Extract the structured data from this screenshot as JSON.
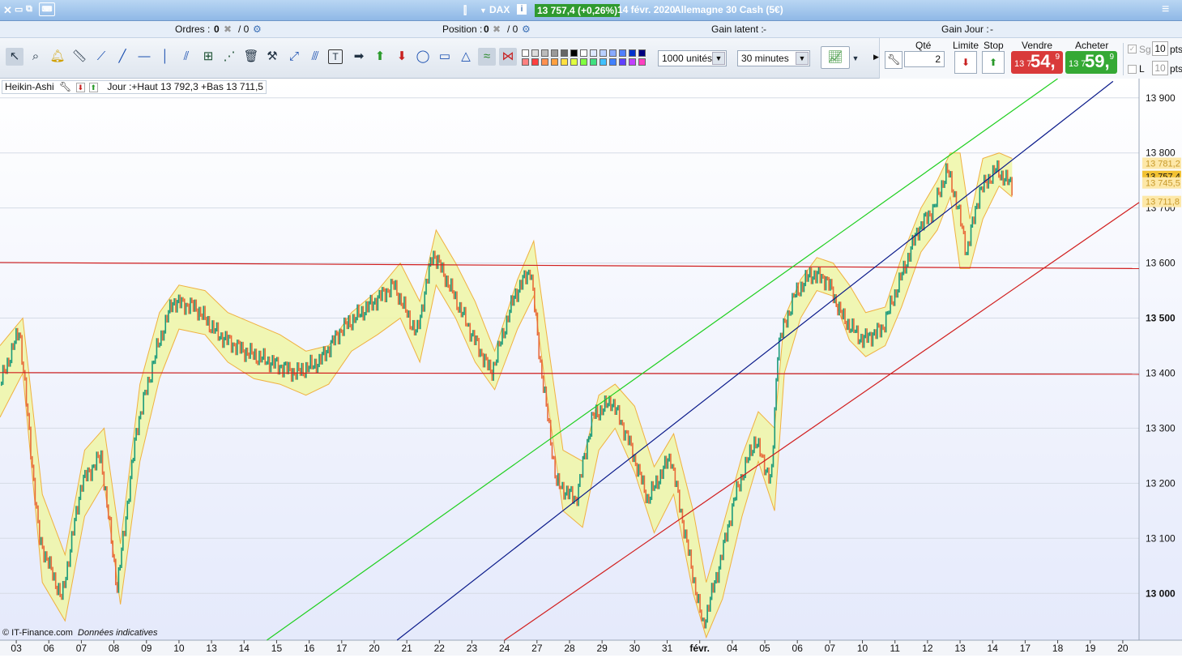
{
  "titlebar": {
    "symbol": "DAX",
    "last_price": "13 757,4 (+0,26%)",
    "date_label": "14 févr. 2020",
    "instrument": "Allemagne 30 Cash (5€)"
  },
  "infobar": {
    "orders_label": "Ordres :",
    "orders_a": "0",
    "orders_b": "/ 0",
    "position_label": "Position :",
    "position_a": "0",
    "position_b": "/ 0",
    "latent_label": "Gain latent :",
    "latent_value": "-",
    "day_label": "Gain Jour :",
    "day_value": "-"
  },
  "toolbar": {
    "swatches": [
      "#ffffff",
      "#dddddd",
      "#bbbbbb",
      "#999999",
      "#666666",
      "#000000",
      "#ffffff",
      "#dde8ff",
      "#b8d0ff",
      "#88aaff",
      "#4f7fff",
      "#0033cc",
      "#000080",
      "#ff8080",
      "#ff4040",
      "#ff9050",
      "#ffa040",
      "#ffe040",
      "#e0ff40",
      "#80ff40",
      "#40e080",
      "#40c0ff",
      "#4080ff",
      "#6040ff",
      "#c040ff",
      "#ff40c0"
    ],
    "units": "1000 unités",
    "interval": "30 minutes"
  },
  "order": {
    "qty_label": "Qté",
    "qty_value": "2",
    "limit_label": "Limite",
    "stop_label": "Stop",
    "sell_label": "Vendre",
    "sell_prefix": "13 7",
    "sell_big": "54,",
    "sell_sup": "9",
    "buy_label": "Acheter",
    "buy_prefix": "13 7",
    "buy_big": "59,",
    "buy_sup": "9",
    "sg_label": "Sg",
    "sg_value": "10",
    "l_label": "L",
    "l_value": "10",
    "pts": "pts"
  },
  "chart_legend": {
    "indicator": "Heikin-Ashi",
    "day_info": "Jour :+Haut 13 792,3 +Bas 13 711,5"
  },
  "footer": {
    "copyright": "© IT-Finance.com",
    "note": "Données indicatives"
  },
  "chart_data": {
    "type": "line",
    "ylim": [
      12915,
      13935
    ],
    "xlim": [
      0,
      35
    ],
    "y_ticks": [
      13900,
      13800,
      13700,
      13600,
      13500,
      13400,
      13300,
      13200,
      13100,
      13000
    ],
    "y_tick_labels": [
      "13 900",
      "13 800",
      "13 700",
      "13 600",
      "13 500",
      "13 400",
      "13 300",
      "13 200",
      "13 100",
      "13 000"
    ],
    "y_bold": [
      13500,
      13000
    ],
    "x_ticks": [
      0.5,
      1.5,
      2.5,
      3.5,
      4.5,
      5.5,
      6.5,
      7.5,
      8.5,
      9.5,
      10.5,
      11.5,
      12.5,
      13.5,
      14.5,
      15.5,
      16.5,
      17.5,
      18.5,
      19.5,
      20.5,
      21.5,
      22.5,
      23.5,
      24.5,
      25.5,
      26.5,
      27.5,
      28.5,
      29.5,
      30.5,
      31.5,
      32.5,
      33.5,
      34.5
    ],
    "x_labels": [
      "03",
      "06",
      "07",
      "08",
      "09",
      "10",
      "13",
      "14",
      "15",
      "16",
      "17",
      "20",
      "21",
      "22",
      "23",
      "24",
      "27",
      "28",
      "29",
      "30",
      "31",
      "févr.",
      "04",
      "05",
      "06",
      "07",
      "10",
      "11",
      "12",
      "13",
      "14",
      "17",
      "18",
      "19",
      "20"
    ],
    "price_points": [
      [
        0,
        13380
      ],
      [
        0.6,
        13480
      ],
      [
        1.2,
        13100
      ],
      [
        1.9,
        12990
      ],
      [
        2.5,
        13200
      ],
      [
        3.1,
        13250
      ],
      [
        3.6,
        13010
      ],
      [
        4.2,
        13300
      ],
      [
        4.8,
        13440
      ],
      [
        5.3,
        13530
      ],
      [
        6.0,
        13520
      ],
      [
        6.7,
        13470
      ],
      [
        7.5,
        13440
      ],
      [
        8.3,
        13420
      ],
      [
        9.1,
        13400
      ],
      [
        9.8,
        13420
      ],
      [
        10.5,
        13480
      ],
      [
        11.3,
        13520
      ],
      [
        12.1,
        13560
      ],
      [
        12.8,
        13470
      ],
      [
        13.3,
        13620
      ],
      [
        13.8,
        13560
      ],
      [
        14.5,
        13470
      ],
      [
        15.1,
        13400
      ],
      [
        15.8,
        13540
      ],
      [
        16.3,
        13590
      ],
      [
        16.6,
        13420
      ],
      [
        17.1,
        13200
      ],
      [
        17.7,
        13170
      ],
      [
        18.2,
        13320
      ],
      [
        18.8,
        13350
      ],
      [
        19.3,
        13280
      ],
      [
        19.9,
        13170
      ],
      [
        20.6,
        13250
      ],
      [
        21.2,
        13060
      ],
      [
        21.6,
        12940
      ],
      [
        22.1,
        13050
      ],
      [
        22.6,
        13180
      ],
      [
        23.2,
        13280
      ],
      [
        23.7,
        13200
      ],
      [
        23.9,
        13450
      ],
      [
        24.4,
        13540
      ],
      [
        24.9,
        13580
      ],
      [
        25.4,
        13570
      ],
      [
        25.9,
        13500
      ],
      [
        26.5,
        13460
      ],
      [
        27.1,
        13480
      ],
      [
        27.6,
        13560
      ],
      [
        28.2,
        13660
      ],
      [
        28.7,
        13700
      ],
      [
        29.1,
        13770
      ],
      [
        29.4,
        13710
      ],
      [
        29.7,
        13620
      ],
      [
        30.1,
        13730
      ],
      [
        30.6,
        13770
      ],
      [
        31.1,
        13740
      ]
    ],
    "band_upper": [
      [
        0,
        13450
      ],
      [
        0.7,
        13500
      ],
      [
        1.3,
        13180
      ],
      [
        2.0,
        13070
      ],
      [
        2.6,
        13260
      ],
      [
        3.2,
        13300
      ],
      [
        3.7,
        13090
      ],
      [
        4.3,
        13380
      ],
      [
        4.9,
        13510
      ],
      [
        5.5,
        13560
      ],
      [
        6.3,
        13550
      ],
      [
        7.0,
        13510
      ],
      [
        7.8,
        13490
      ],
      [
        8.6,
        13470
      ],
      [
        9.4,
        13440
      ],
      [
        10.1,
        13450
      ],
      [
        10.8,
        13510
      ],
      [
        11.6,
        13550
      ],
      [
        12.3,
        13600
      ],
      [
        12.9,
        13530
      ],
      [
        13.4,
        13660
      ],
      [
        14.0,
        13600
      ],
      [
        14.6,
        13530
      ],
      [
        15.2,
        13440
      ],
      [
        15.9,
        13570
      ],
      [
        16.4,
        13640
      ],
      [
        16.8,
        13470
      ],
      [
        17.3,
        13260
      ],
      [
        17.9,
        13240
      ],
      [
        18.4,
        13360
      ],
      [
        18.9,
        13380
      ],
      [
        19.5,
        13340
      ],
      [
        20.1,
        13230
      ],
      [
        20.7,
        13290
      ],
      [
        21.3,
        13150
      ],
      [
        21.7,
        13020
      ],
      [
        22.2,
        13120
      ],
      [
        22.8,
        13250
      ],
      [
        23.3,
        13330
      ],
      [
        23.8,
        13300
      ],
      [
        24.1,
        13500
      ],
      [
        24.6,
        13570
      ],
      [
        25.1,
        13610
      ],
      [
        25.6,
        13600
      ],
      [
        26.1,
        13560
      ],
      [
        26.6,
        13510
      ],
      [
        27.2,
        13520
      ],
      [
        27.7,
        13610
      ],
      [
        28.3,
        13700
      ],
      [
        28.8,
        13750
      ],
      [
        29.2,
        13800
      ],
      [
        29.5,
        13800
      ],
      [
        29.8,
        13680
      ],
      [
        30.2,
        13790
      ],
      [
        30.7,
        13800
      ],
      [
        31.1,
        13790
      ]
    ],
    "band_lower": [
      [
        0,
        13320
      ],
      [
        0.7,
        13400
      ],
      [
        1.3,
        13020
      ],
      [
        2.0,
        12950
      ],
      [
        2.6,
        13140
      ],
      [
        3.2,
        13200
      ],
      [
        3.7,
        12980
      ],
      [
        4.3,
        13240
      ],
      [
        4.9,
        13390
      ],
      [
        5.5,
        13480
      ],
      [
        6.3,
        13470
      ],
      [
        7.0,
        13420
      ],
      [
        7.8,
        13390
      ],
      [
        8.6,
        13380
      ],
      [
        9.4,
        13360
      ],
      [
        10.1,
        13380
      ],
      [
        10.8,
        13440
      ],
      [
        11.6,
        13470
      ],
      [
        12.3,
        13500
      ],
      [
        12.9,
        13420
      ],
      [
        13.4,
        13560
      ],
      [
        14.0,
        13500
      ],
      [
        14.6,
        13420
      ],
      [
        15.2,
        13370
      ],
      [
        15.9,
        13480
      ],
      [
        16.4,
        13540
      ],
      [
        16.8,
        13360
      ],
      [
        17.3,
        13150
      ],
      [
        17.9,
        13120
      ],
      [
        18.4,
        13260
      ],
      [
        18.9,
        13300
      ],
      [
        19.5,
        13220
      ],
      [
        20.1,
        13110
      ],
      [
        20.7,
        13180
      ],
      [
        21.3,
        13000
      ],
      [
        21.7,
        12920
      ],
      [
        22.2,
        12990
      ],
      [
        22.8,
        13140
      ],
      [
        23.3,
        13240
      ],
      [
        23.8,
        13150
      ],
      [
        24.1,
        13400
      ],
      [
        24.6,
        13500
      ],
      [
        25.1,
        13550
      ],
      [
        25.6,
        13540
      ],
      [
        26.1,
        13460
      ],
      [
        26.6,
        13430
      ],
      [
        27.2,
        13450
      ],
      [
        27.7,
        13520
      ],
      [
        28.3,
        13620
      ],
      [
        28.8,
        13660
      ],
      [
        29.2,
        13720
      ],
      [
        29.5,
        13590
      ],
      [
        29.8,
        13590
      ],
      [
        30.2,
        13680
      ],
      [
        30.7,
        13740
      ],
      [
        31.1,
        13720
      ]
    ],
    "lines": [
      {
        "color": "#d11f1f",
        "points": [
          [
            0,
            13601
          ],
          [
            35,
            13590
          ]
        ]
      },
      {
        "color": "#d11f1f",
        "points": [
          [
            0,
            13401
          ],
          [
            35,
            13398
          ]
        ]
      },
      {
        "color": "#1fcf1f",
        "points": [
          [
            8.2,
            12915
          ],
          [
            32.5,
            13935
          ]
        ]
      },
      {
        "color": "#0a1a8a",
        "points": [
          [
            12.2,
            12915
          ],
          [
            34.2,
            13930
          ]
        ]
      },
      {
        "color": "#d11f1f",
        "points": [
          [
            15.5,
            12915
          ],
          [
            35,
            13710
          ]
        ]
      }
    ],
    "price_tags": [
      {
        "value": 13781.2,
        "label": "13 781,2",
        "bg": "#fde8a8",
        "fg": "#c89a2c"
      },
      {
        "value": 13757.4,
        "label": "13 757,4",
        "bg": "#f2c233",
        "fg": "#111111"
      },
      {
        "value": 13745.5,
        "label": "13 745,5",
        "bg": "#fde8a8",
        "fg": "#c89a2c"
      },
      {
        "value": 13711.8,
        "label": "13 711,8",
        "bg": "#fde8a8",
        "fg": "#c89a2c"
      }
    ]
  }
}
